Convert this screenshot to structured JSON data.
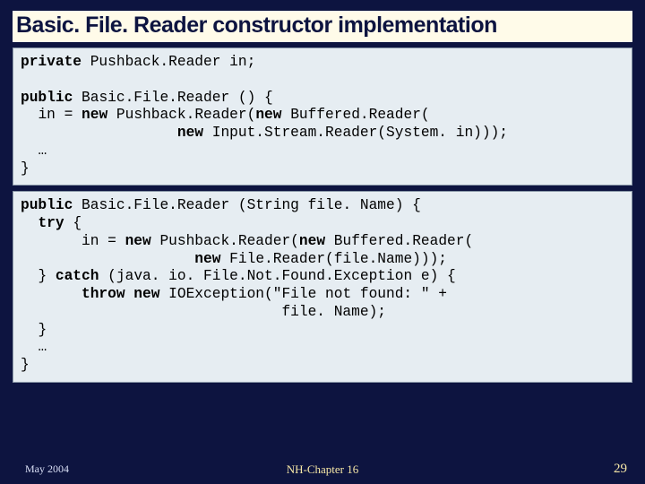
{
  "title": "Basic. File. Reader constructor implementation",
  "code_block1": "private Pushback.Reader in;\n\npublic Basic.File.Reader () {\n  in = new Pushback.Reader(new Buffered.Reader(\n                  new Input.Stream.Reader(System. in)));\n  …\n}",
  "code_block2": "public Basic.File.Reader (String file. Name) {\n  try {\n       in = new Pushback.Reader(new Buffered.Reader(\n                    new File.Reader(file.Name)));\n  } catch (java. io. File.Not.Found.Exception e) {\n       throw new IOException(\"File not found: \" +\n                              file. Name);\n  }\n  …\n}",
  "footer": {
    "left": "May 2004",
    "center": "NH-Chapter 16",
    "right": "29"
  }
}
